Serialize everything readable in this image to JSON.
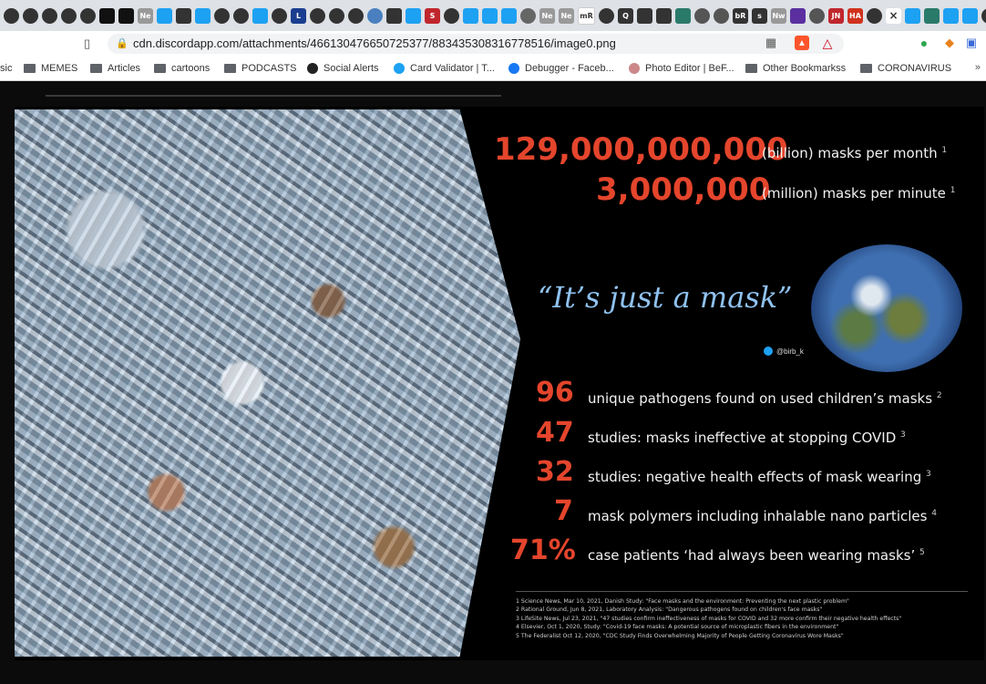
{
  "browser": {
    "url": "cdn.discordapp.com/attachments/466130476650725377/883435308316778516/image0.png",
    "bookmarks": [
      {
        "label": "sic",
        "type": "text"
      },
      {
        "label": "MEMES",
        "type": "folder"
      },
      {
        "label": "Articles",
        "type": "folder"
      },
      {
        "label": "cartoons",
        "type": "folder"
      },
      {
        "label": "PODCASTS",
        "type": "folder"
      },
      {
        "label": "Social Alerts",
        "type": "site"
      },
      {
        "label": "Card Validator | T...",
        "type": "site"
      },
      {
        "label": "Debugger - Faceb...",
        "type": "site"
      },
      {
        "label": "Photo Editor | BeF...",
        "type": "site"
      },
      {
        "label": "Other Bookmarkss",
        "type": "folder"
      },
      {
        "label": "CORONAVIRUS",
        "type": "folder"
      }
    ],
    "more_bookmarks": "»",
    "tab_labels": [
      "Ne",
      "Ne",
      "Ne",
      "mR",
      "Q",
      "bR",
      "Nw",
      "Ne",
      "HA",
      "JN",
      "S",
      "L",
      "s"
    ]
  },
  "slide": {
    "stat_top_1_number": "129,000,000,000",
    "stat_top_1_label": "(billion) masks per month",
    "stat_top_1_ref": "1",
    "stat_top_2_number": "3,000,000",
    "stat_top_2_label": "(million) masks per minute",
    "stat_top_2_ref": "1",
    "quote": "“It’s just a mask”",
    "handle": "@birb_k",
    "stats": [
      {
        "number": "96",
        "label": "unique pathogens found on used children’s masks",
        "ref": "2"
      },
      {
        "number": "47",
        "label": "studies: masks ineffective at stopping COVID",
        "ref": "3"
      },
      {
        "number": "32",
        "label": "studies: negative health effects of mask wearing",
        "ref": "3"
      },
      {
        "number": "7",
        "label": "mask polymers including inhalable nano particles",
        "ref": "4"
      },
      {
        "number": "71%",
        "label": "case patients ‘had always been wearing masks’",
        "ref": "5"
      }
    ],
    "references": [
      "1  Science News, Mar 10, 2021, Danish Study: \"Face masks and the environment: Preventing the next plastic problem\"",
      "2  Rational Ground, Jun 8, 2021, Laboratory Analysis: \"Dangerous pathogens found on children's face masks\"",
      "3  LifeSite News, Jul 23, 2021, \"47 studies confirm ineffectiveness of masks for COVID and 32 more confirm their negative health effects\"",
      "4  Elsevier, Oct 1, 2020, Study: \"Covid-19 face masks: A potential source of microplastic fibers in the environment\"",
      "5  The Federalist Oct 12, 2020, \"CDC Study Finds Overwhelming Majority of People Getting Coronavirus Wore Masks\""
    ]
  }
}
